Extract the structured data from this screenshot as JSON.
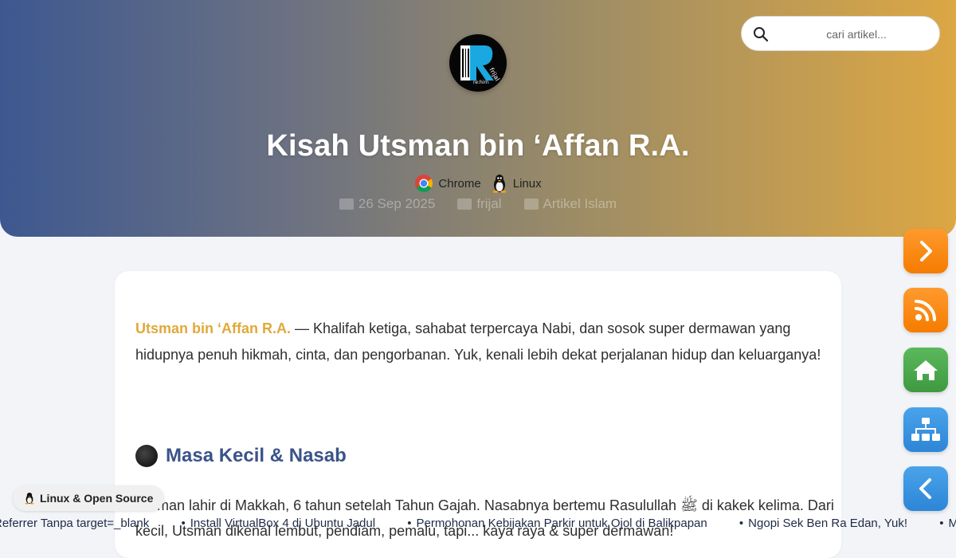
{
  "search": {
    "placeholder": "cari artikel..."
  },
  "article": {
    "title": "Kisah Utsman bin ‘Affan R.A.",
    "browser": "Chrome",
    "os": "Linux",
    "date": "26 Sep 2025",
    "author": "frijal",
    "category": "Artikel Islam",
    "intro_highlight": "Utsman bin ‘Affan R.A.",
    "intro_rest": " — Khalifah ketiga, sahabat terpercaya Nabi, dan sosok super dermawan yang hidupnya penuh hikmah, cinta, dan pengorbanan. Yuk, kenali lebih dekat perjalanan hidup dan keluarganya!",
    "section_heading": "Masa Kecil & Nasab",
    "section_text": "Utsman lahir di Makkah, 6 tahun setelah Tahun Gajah. Nasabnya bertemu Rasulullah ﷺ di kakek kelima. Dari kecil, Utsman dikenal lembut, pendiam, pemalu, tapi... kaya raya & super dermawan!"
  },
  "tag": {
    "label": "Linux & Open Source"
  },
  "ticker": {
    "items": [
      "Referrer Tanpa target=_blank",
      "Install VirtualBox 4 di Ubuntu Jadul",
      "Permohonan Kebijakan Parkir untuk Ojol di Balikpapan",
      "Ngopi Sek Ben Ra Edan, Yuk!",
      "Mengenal"
    ]
  },
  "side_buttons": {
    "next_icon": "chevron-right-icon",
    "rss_icon": "rss-icon",
    "home_icon": "home-icon",
    "sitemap_icon": "sitemap-icon",
    "prev_icon": "chevron-left-icon"
  },
  "colors": {
    "accent_orange": "#f57c00",
    "accent_green": "#3f9a3f",
    "accent_blue": "#2d86d6",
    "heading_blue": "#3a5389",
    "highlight_gold": "#e0a93a"
  }
}
